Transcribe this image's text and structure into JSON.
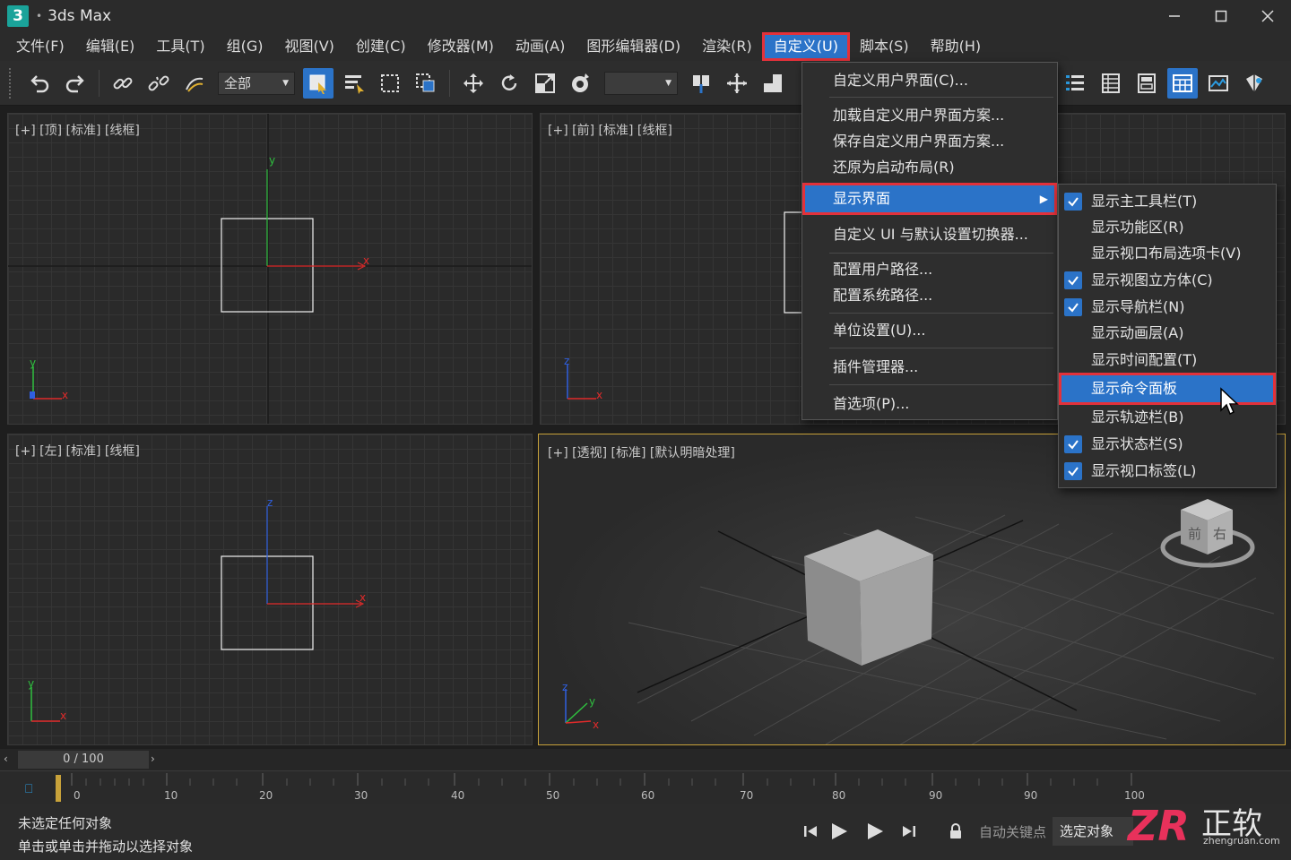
{
  "app": {
    "logo_text": "3",
    "title": "3ds Max"
  },
  "menubar": {
    "items": [
      "文件(F)",
      "编辑(E)",
      "工具(T)",
      "组(G)",
      "视图(V)",
      "创建(C)",
      "修改器(M)",
      "动画(A)",
      "图形编辑器(D)",
      "渲染(R)",
      "自定义(U)",
      "脚本(S)",
      "帮助(H)"
    ],
    "active_index": 10
  },
  "toolbar": {
    "selection_filter": "全部",
    "named_selection": ""
  },
  "viewports": {
    "top": "[+] [顶] [标准] [线框]",
    "front": "[+] [前] [标准] [线框]",
    "left": "[+] [左] [标准] [线框]",
    "persp": "[+] [透视] [标准] [默认明暗处理]"
  },
  "axis": {
    "x": "x",
    "y": "y",
    "z": "z"
  },
  "viewcube": {
    "front": "前",
    "right": "右"
  },
  "customize_menu": {
    "items": [
      "自定义用户界面(C)...",
      "加载自定义用户界面方案...",
      "保存自定义用户界面方案...",
      "还原为启动布局(R)",
      "显示界面",
      "自定义 UI 与默认设置切换器...",
      "配置用户路径...",
      "配置系统路径...",
      "单位设置(U)...",
      "插件管理器...",
      "首选项(P)..."
    ],
    "highlighted_index": 4
  },
  "show_ui_submenu": {
    "items": [
      {
        "label": "显示主工具栏(T)",
        "checked": true
      },
      {
        "label": "显示功能区(R)",
        "checked": false
      },
      {
        "label": "显示视口布局选项卡(V)",
        "checked": false
      },
      {
        "label": "显示视图立方体(C)",
        "checked": true
      },
      {
        "label": "显示导航栏(N)",
        "checked": true
      },
      {
        "label": "显示动画层(A)",
        "checked": false
      },
      {
        "label": "显示时间配置(T)",
        "checked": false
      },
      {
        "label": "显示命令面板",
        "checked": false
      },
      {
        "label": "显示轨迹栏(B)",
        "checked": false
      },
      {
        "label": "显示状态栏(S)",
        "checked": true
      },
      {
        "label": "显示视口标签(L)",
        "checked": true
      }
    ],
    "highlighted_index": 7
  },
  "timeline": {
    "slider_text": "0 / 100",
    "tick_labels": [
      "0",
      "10",
      "20",
      "30",
      "40",
      "50",
      "60",
      "70",
      "80",
      "90",
      "90",
      "100"
    ]
  },
  "status": {
    "line1": "未选定任何对象",
    "line2": "单击或单击并拖动以选择对象",
    "auto_key": "自动关键点",
    "selected_object": "选定对象"
  },
  "watermark": {
    "text": "正软",
    "sub": "zhengruan.com"
  },
  "colors": {
    "accent": "#2b73c8",
    "highlight_border": "#e3313a",
    "viewport_active_border": "#c8a23a",
    "axis_x": "#e02a2a",
    "axis_y": "#2fbf3f",
    "axis_z": "#2f5fe0"
  }
}
